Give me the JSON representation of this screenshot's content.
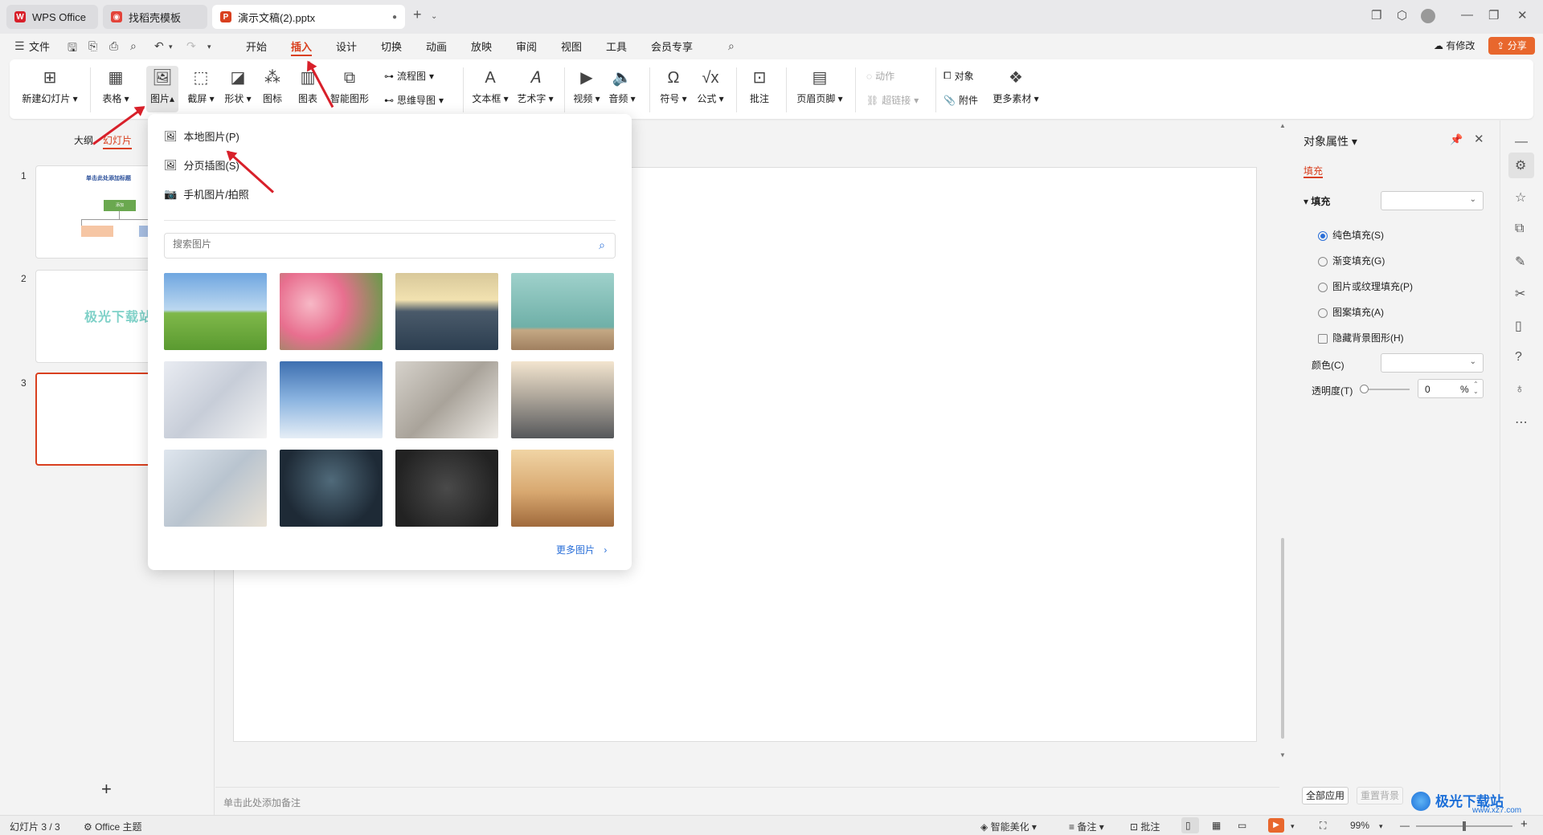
{
  "tabs": [
    {
      "label": "WPS Office"
    },
    {
      "label": "找稻壳模板"
    },
    {
      "label": "演示文稿(2).pptx"
    }
  ],
  "menubar": {
    "file": "文件",
    "items": [
      "开始",
      "插入",
      "设计",
      "切换",
      "动画",
      "放映",
      "审阅",
      "视图",
      "工具",
      "会员专享"
    ],
    "active": "插入",
    "modified": "有修改",
    "share": "分享"
  },
  "ribbon": {
    "new_slide": "新建幻灯片",
    "table": "表格",
    "picture": "图片",
    "screenshot": "截屏",
    "shape": "形状",
    "icon": "图标",
    "chart": "图表",
    "smart_graphic": "智能图形",
    "flowchart": "流程图",
    "mindmap": "思维导图",
    "textbox": "文本框",
    "wordart": "艺术字",
    "video": "视频",
    "audio": "音频",
    "symbol": "符号",
    "formula": "公式",
    "comment": "批注",
    "header_footer": "页眉页脚",
    "action": "动作",
    "hyperlink": "超链接",
    "object": "对象",
    "attachment": "附件",
    "more_material": "更多素材"
  },
  "leftpanel": {
    "tab_outline": "大纲",
    "tab_slides": "幻灯片",
    "slides": [
      {
        "num": "1",
        "title": "单击此处添加标题",
        "box": "添加"
      },
      {
        "num": "2",
        "text": "极光下载站"
      },
      {
        "num": "3"
      }
    ],
    "add": "+"
  },
  "dropdown": {
    "local_picture": "本地图片(P)",
    "paged_insert": "分页插图(S)",
    "phone_picture": "手机图片/拍照",
    "search_placeholder": "搜索图片",
    "more_pictures": "更多图片",
    "images": [
      "tree-field",
      "pink-tulips",
      "solar-farm-sunset",
      "teal-wall-apple",
      "hands-phone",
      "airplane-sky",
      "hands-document",
      "treadmills-gym",
      "raised-fists",
      "man-laptop-celebrating",
      "chalkboard-question-marks",
      "galloping-horse"
    ]
  },
  "notes_placeholder": "单击此处添加备注",
  "rightpanel": {
    "title": "对象属性",
    "tab_fill": "填充",
    "section_fill": "填充",
    "options": [
      "纯色填充(S)",
      "渐变填充(G)",
      "图片或纹理填充(P)",
      "图案填充(A)"
    ],
    "hide_bg": "隐藏背景图形(H)",
    "color_label": "颜色(C)",
    "transparency_label": "透明度(T)",
    "transparency_value": "0",
    "percent": "%",
    "apply_all": "全部应用",
    "reset_bg": "重置背景"
  },
  "statusbar": {
    "slide_info": "幻灯片 3 / 3",
    "theme": "Office 主题",
    "beautify": "智能美化",
    "notes": "备注",
    "comment": "批注",
    "zoom": "99%"
  },
  "watermark": "极光下载站",
  "watermark_url": "www.xz7.com",
  "colors": {
    "accent": "#d9401f",
    "blue": "#2a6fd8"
  }
}
